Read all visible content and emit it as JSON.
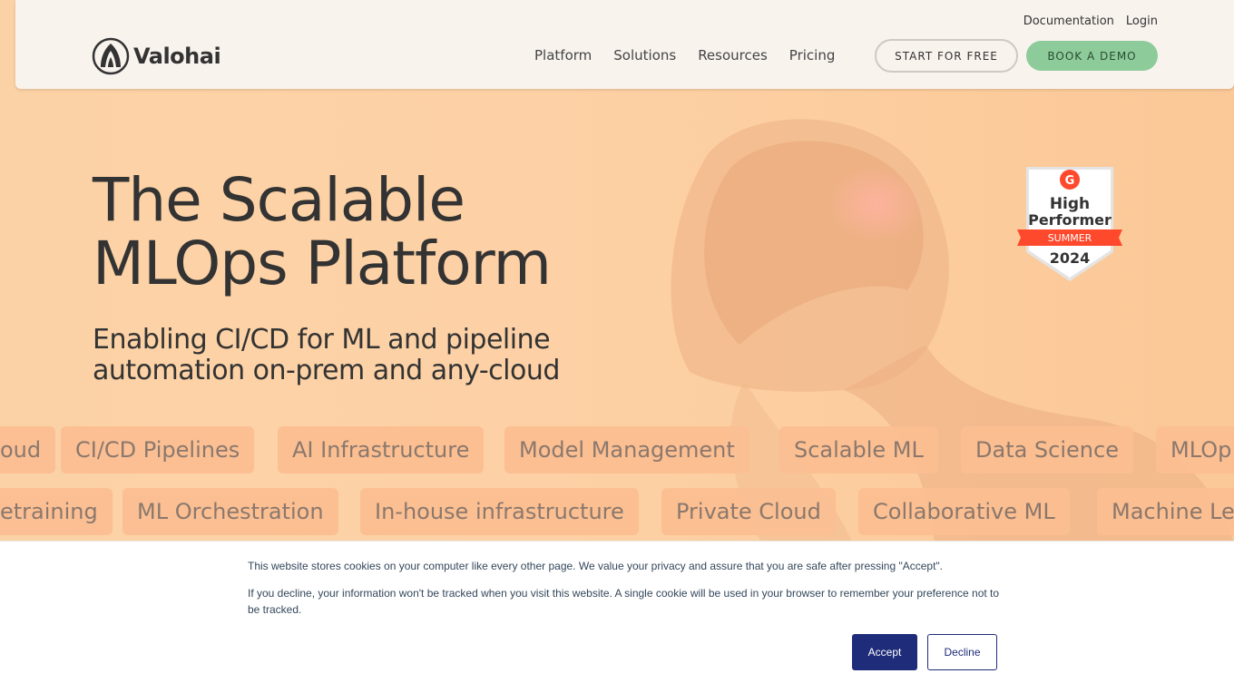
{
  "brand": {
    "name": "Valohai"
  },
  "header": {
    "top_links": [
      "Documentation",
      "Login"
    ],
    "nav": [
      "Platform",
      "Solutions",
      "Resources",
      "Pricing"
    ],
    "start_free": "START FOR FREE",
    "book_demo": "BOOK A DEMO"
  },
  "hero": {
    "title_line1": "The Scalable",
    "title_line2": "MLOps Platform",
    "subtitle_line1": "Enabling CI/CD for ML and pipeline",
    "subtitle_line2": "automation on-prem and any-cloud"
  },
  "badge": {
    "line1": "High",
    "line2": "Performer",
    "season": "SUMMER",
    "year": "2024"
  },
  "tags_row1": [
    "oud",
    "CI/CD Pipelines",
    "AI Infrastructure",
    "Model Management",
    "Scalable ML",
    "Data Science",
    "MLOp"
  ],
  "tags_row2": [
    "etraining",
    "ML Orchestration",
    "In-house infrastructure",
    "Private Cloud",
    "Collaborative ML",
    "Machine Le"
  ],
  "cookie": {
    "text1": "This website stores cookies on your computer like every other page. We value your privacy and assure that you are safe after pressing \"Accept\".",
    "text2": "If you decline, your information won't be tracked when you visit this website. A single cookie will be used in your browser to remember your preference not to be tracked.",
    "accept": "Accept",
    "decline": "Decline"
  },
  "colors": {
    "hero_bg": "#fccea0",
    "tag_bg": "#fbbf92",
    "demo_button": "#8dcc9a",
    "accept_button": "#1f2c7a",
    "badge_red": "#ff492c"
  }
}
